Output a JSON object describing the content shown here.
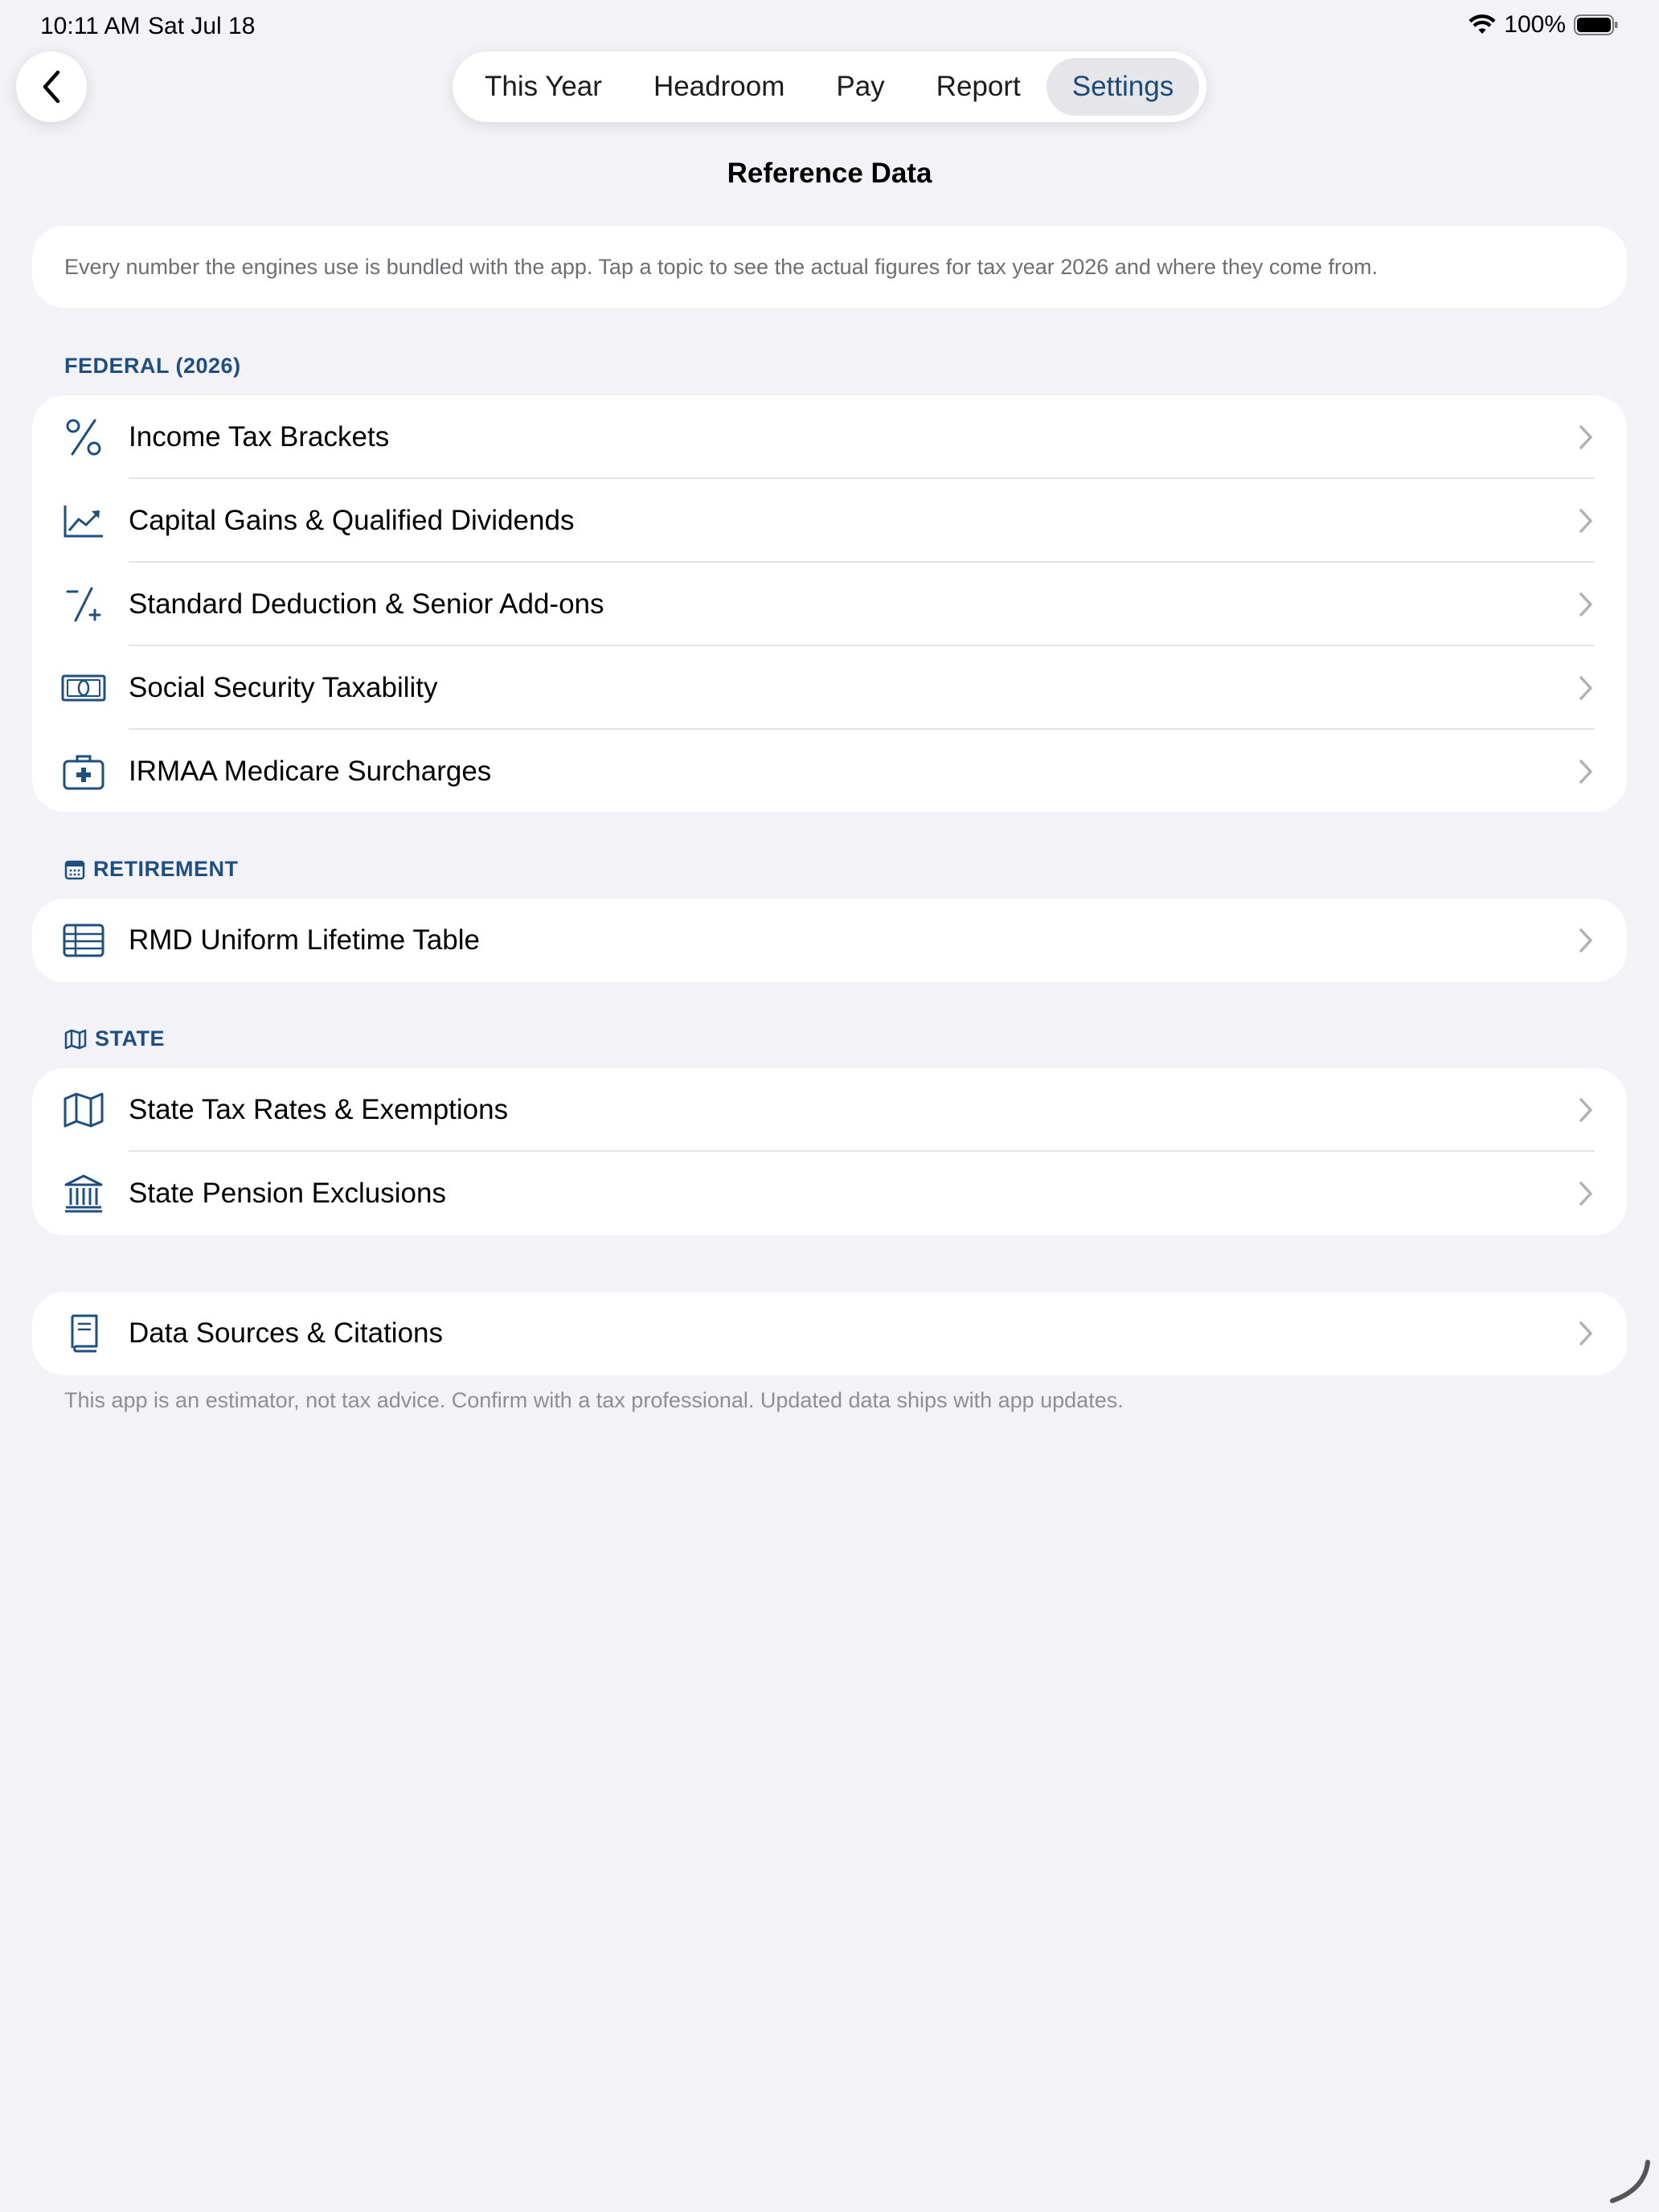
{
  "status_bar": {
    "time": "10:11 AM",
    "date": "Sat Jul 18",
    "battery": "100%"
  },
  "tabs": [
    {
      "label": "This Year",
      "active": false
    },
    {
      "label": "Headroom",
      "active": false
    },
    {
      "label": "Pay",
      "active": false
    },
    {
      "label": "Report",
      "active": false
    },
    {
      "label": "Settings",
      "active": true
    }
  ],
  "page_title": "Reference Data",
  "intro_text": "Every number the engines use is bundled with the app. Tap a topic to see the actual figures for tax year 2026 and where they come from.",
  "sections": {
    "federal": {
      "header": "FEDERAL (2026)",
      "items": [
        {
          "label": "Income Tax Brackets",
          "icon": "percent-icon"
        },
        {
          "label": "Capital Gains & Qualified Dividends",
          "icon": "chart-line-uptrend-icon"
        },
        {
          "label": "Standard Deduction & Senior Add-ons",
          "icon": "plus-minus-slash-icon"
        },
        {
          "label": "Social Security Taxability",
          "icon": "banknote-icon"
        },
        {
          "label": "IRMAA Medicare Surcharges",
          "icon": "cross-case-icon"
        }
      ]
    },
    "retirement": {
      "header": "RETIREMENT",
      "icon": "calendar-icon",
      "items": [
        {
          "label": "RMD Uniform Lifetime Table",
          "icon": "table-icon"
        }
      ]
    },
    "state": {
      "header": "STATE",
      "icon": "map-icon",
      "items": [
        {
          "label": "State Tax Rates & Exemptions",
          "icon": "map-icon"
        },
        {
          "label": "State Pension Exclusions",
          "icon": "building-columns-icon"
        }
      ]
    },
    "sources": {
      "items": [
        {
          "label": "Data Sources & Citations",
          "icon": "book-icon"
        }
      ]
    }
  },
  "footer_note": "This app is an estimator, not tax advice. Confirm with a tax professional. Updated data ships with app updates.",
  "colors": {
    "accent": "#1e4f80",
    "background": "#f2f2f7",
    "card": "#ffffff",
    "secondary_text": "#8e8e93"
  }
}
